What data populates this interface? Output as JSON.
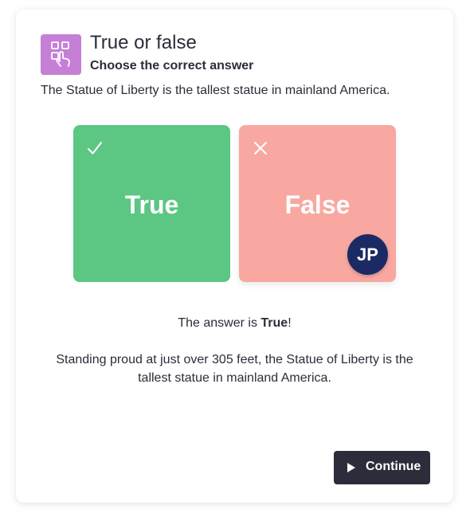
{
  "header": {
    "icon": "tap-grid-icon",
    "title": "True or false",
    "subtitle": "Choose the correct answer"
  },
  "question": "The Statue of Liberty is the tallest statue in mainland America.",
  "options": [
    {
      "label": "True",
      "icon": "checkmark-icon",
      "color": "#5cc683"
    },
    {
      "label": "False",
      "icon": "cross-icon",
      "color": "#f8a8a1",
      "selected_by": "JP"
    }
  ],
  "result": {
    "prefix": "The answer is ",
    "answer": "True",
    "suffix": "!",
    "explanation": "Standing proud at just over 305 feet, the Statue of Liberty is the tallest statue in mainland America."
  },
  "actions": {
    "continue_label": "Continue",
    "continue_icon": "play-icon"
  },
  "colors": {
    "accent": "#c57fd6",
    "true": "#5cc683",
    "false": "#f8a8a1",
    "avatar": "#1c2a63",
    "button": "#2b2d3a"
  }
}
